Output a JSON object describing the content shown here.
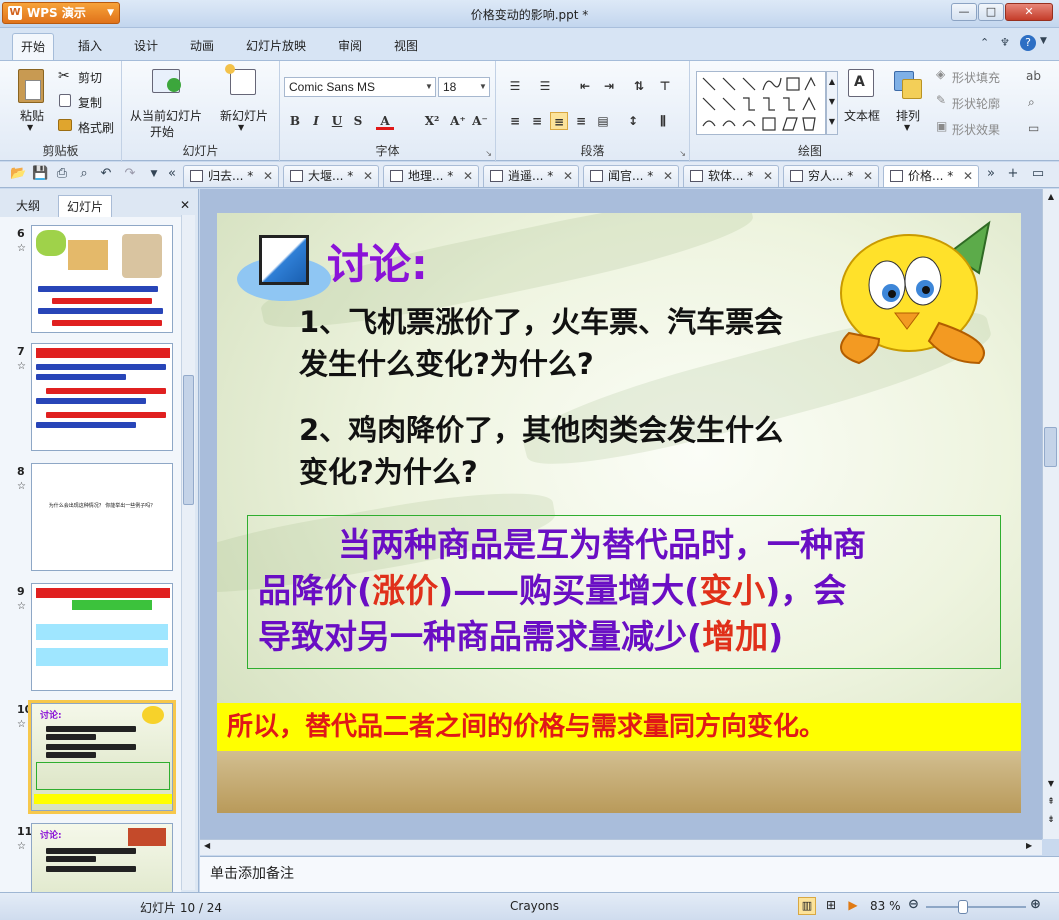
{
  "app": {
    "name": "WPS 演示",
    "window_title": "价格变动的影响.ppt *"
  },
  "window_buttons": {
    "minimize": "—",
    "maximize": "□",
    "close": "✕"
  },
  "ribbon_tabs": [
    "开始",
    "插入",
    "设计",
    "动画",
    "幻灯片放映",
    "审阅",
    "视图"
  ],
  "ribbon": {
    "clipboard": {
      "label": "剪贴板",
      "paste": "粘贴",
      "cut": "剪切",
      "copy": "复制",
      "format_painter": "格式刷"
    },
    "slides": {
      "label": "幻灯片",
      "from_current_line1": "从当前幻灯片",
      "from_current_line2": "开始",
      "new_slide": "新幻灯片"
    },
    "font": {
      "label": "字体",
      "font_name": "Comic Sans MS",
      "font_size": "18",
      "bold": "B",
      "italic": "I",
      "underline": "U",
      "shadow": "S",
      "font_color": "A",
      "superscript": "X²",
      "grow": "A⁺",
      "shrink": "A⁻"
    },
    "paragraph": {
      "label": "段落"
    },
    "drawing": {
      "label": "绘图",
      "textbox": "文本框",
      "arrange": "排列",
      "shape_fill": "形状填充",
      "shape_outline": "形状轮廓",
      "shape_effect": "形状效果"
    }
  },
  "doc_tabs": [
    {
      "label": "归去...",
      "mod": "*"
    },
    {
      "label": "大堰...",
      "mod": "*"
    },
    {
      "label": "地理...",
      "mod": "*"
    },
    {
      "label": "逍遥...",
      "mod": "*"
    },
    {
      "label": "闻官...",
      "mod": "*"
    },
    {
      "label": "软体...",
      "mod": "*"
    },
    {
      "label": "穷人...",
      "mod": "*"
    },
    {
      "label": "价格...",
      "mod": "*"
    }
  ],
  "left_panel": {
    "tab_outline": "大纲",
    "tab_slides": "幻灯片",
    "close": "✕"
  },
  "thumbnails": [
    {
      "num": "6",
      "star": "☆"
    },
    {
      "num": "7",
      "star": "☆"
    },
    {
      "num": "8",
      "star": "☆",
      "text": "为什么会出现这种情况？ 你能举出一些例子吗？"
    },
    {
      "num": "9",
      "star": "☆"
    },
    {
      "num": "10",
      "star": "☆",
      "title": "讨论:"
    },
    {
      "num": "11",
      "star": "☆",
      "title": "讨论:"
    }
  ],
  "slide": {
    "title": "讨论:",
    "q1_line1": "1、飞机票涨价了，火车票、汽车票会",
    "q1_line2": "发生什么变化?为什么?",
    "q2_line1": "2、鸡肉降价了，其他肉类会发生什么",
    "q2_line2": "变化?为什么?",
    "box_a": "当两种商品是互为替代品时，一种商",
    "box_b1": "品降价(",
    "box_b2": "涨价",
    "box_b3": ")——购买量增大(",
    "box_b4": "变小",
    "box_b5": ")，会",
    "box_c1": "导致对另一种商品需求量减少(",
    "box_c2": "增加",
    "box_c3": ")",
    "conclusion": "所以，替代品二者之间的价格与需求量同方向变化。"
  },
  "notes_placeholder": "单击添加备注",
  "status": {
    "slide_pos": "幻灯片 10 / 24",
    "theme": "Crayons",
    "zoom": "83 %"
  },
  "colors": {
    "title_purple": "#8a12d8",
    "box_purple": "#6a0ec4",
    "highlight_red": "#e0301a",
    "conclusion_bg": "#ffff00",
    "conclusion_text": "#e01818"
  }
}
